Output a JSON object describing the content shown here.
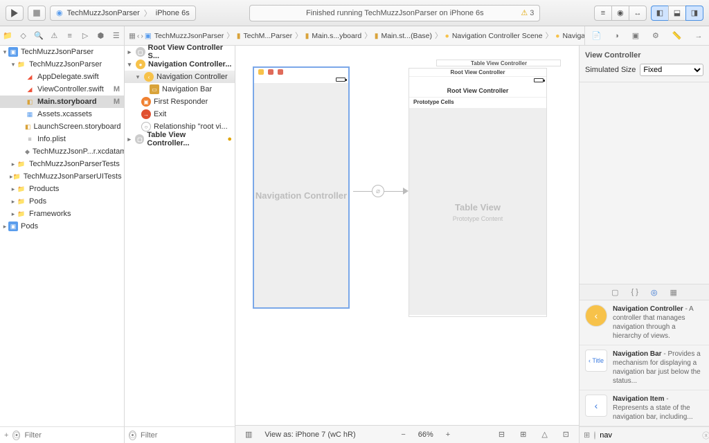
{
  "toolbar": {
    "scheme_app": "TechMuzzJsonParser",
    "scheme_device": "iPhone 6s",
    "status_text": "Finished running TechMuzzJsonParser on iPhone 6s",
    "warning_count": "3"
  },
  "breadcrumbs": [
    "TechMuzzJsonParser",
    "TechM...Parser",
    "Main.s...yboard",
    "Main.st...(Base)",
    "Navigation Controller Scene",
    "Navigation Controller"
  ],
  "navigator": {
    "root": "TechMuzzJsonParser",
    "group": "TechMuzzJsonParser",
    "files": [
      {
        "name": "AppDelegate.swift",
        "m": ""
      },
      {
        "name": "ViewController.swift",
        "m": "M"
      },
      {
        "name": "Main.storyboard",
        "m": "M",
        "sel": true
      },
      {
        "name": "Assets.xcassets",
        "m": ""
      },
      {
        "name": "LaunchScreen.storyboard",
        "m": ""
      },
      {
        "name": "Info.plist",
        "m": ""
      },
      {
        "name": "TechMuzzJsonP...r.xcdatamodeld",
        "m": ""
      }
    ],
    "folders": [
      "TechMuzzJsonParserTests",
      "TechMuzzJsonParserUITests",
      "Products",
      "Pods",
      "Frameworks"
    ],
    "bottom": "Pods",
    "filter_placeholder": "Filter"
  },
  "outline": {
    "scenes": [
      {
        "label": "Root View Controller S...",
        "open": false
      },
      {
        "label": "Navigation Controller...",
        "open": true,
        "children": [
          {
            "label": "Navigation Controller",
            "sel": true,
            "ic": "nav",
            "children": [
              {
                "label": "Navigation Bar",
                "ic": "bar"
              }
            ]
          },
          {
            "label": "First Responder",
            "ic": "fr"
          },
          {
            "label": "Exit",
            "ic": "exit"
          },
          {
            "label": "Relationship \"root vi...",
            "ic": "rel"
          }
        ]
      },
      {
        "label": "Table View Controller...",
        "open": false,
        "warn": true
      }
    ],
    "filter_placeholder": "Filter"
  },
  "canvas": {
    "nc_label": "Navigation Controller",
    "root_scene_title": "Root View Controller",
    "tvc_title": "Table View Controller",
    "root_nav_title": "Root View Controller",
    "proto_label": "Prototype Cells",
    "table_view": "Table View",
    "proto_content": "Prototype Content",
    "view_as": "View as: iPhone 7 (wC hR)",
    "zoom": "66%"
  },
  "inspector": {
    "section": "View Controller",
    "size_label": "Simulated Size",
    "size_value": "Fixed",
    "library": [
      {
        "title": "Navigation Controller",
        "desc": " - A controller that manages navigation through a hierarchy of views.",
        "thumb": "nav"
      },
      {
        "title": "Navigation Bar",
        "desc": " - Provides a mechanism for displaying a navigation bar just below the status...",
        "thumb": "bar"
      },
      {
        "title": "Navigation Item",
        "desc": " - Represents a state of the navigation bar, including...",
        "thumb": "item"
      }
    ],
    "filter_value": "nav"
  }
}
